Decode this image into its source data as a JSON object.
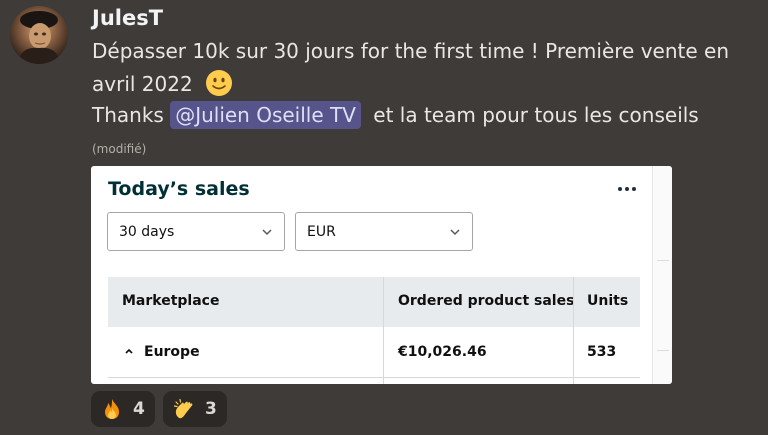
{
  "message": {
    "username": "JulesT",
    "line1": "Dépasser 10k sur 30 jours for the first time ! Première vente en",
    "line2": "avril 2022",
    "line3_prefix": "Thanks",
    "mention": "@Julien Oseille TV",
    "line3_suffix": "et la team pour tous les conseils",
    "edited_label": "(modifié)"
  },
  "card": {
    "title": "Today’s sales",
    "period_select": "30 days",
    "currency_select": "EUR",
    "table": {
      "headers": [
        "Marketplace",
        "Ordered product sales",
        "Units"
      ],
      "rows": [
        {
          "marketplace": "Europe",
          "sales": "€10,026.46",
          "units": "533"
        }
      ]
    }
  },
  "reactions": [
    {
      "icon": "fire-emoji",
      "count": "4"
    },
    {
      "icon": "clapping-hands-emoji",
      "count": "3"
    }
  ],
  "colors": {
    "background": "#3f3b38",
    "mention_bg": "#56548a",
    "card_title": "#002f36",
    "table_header_bg": "#e8ebee"
  }
}
